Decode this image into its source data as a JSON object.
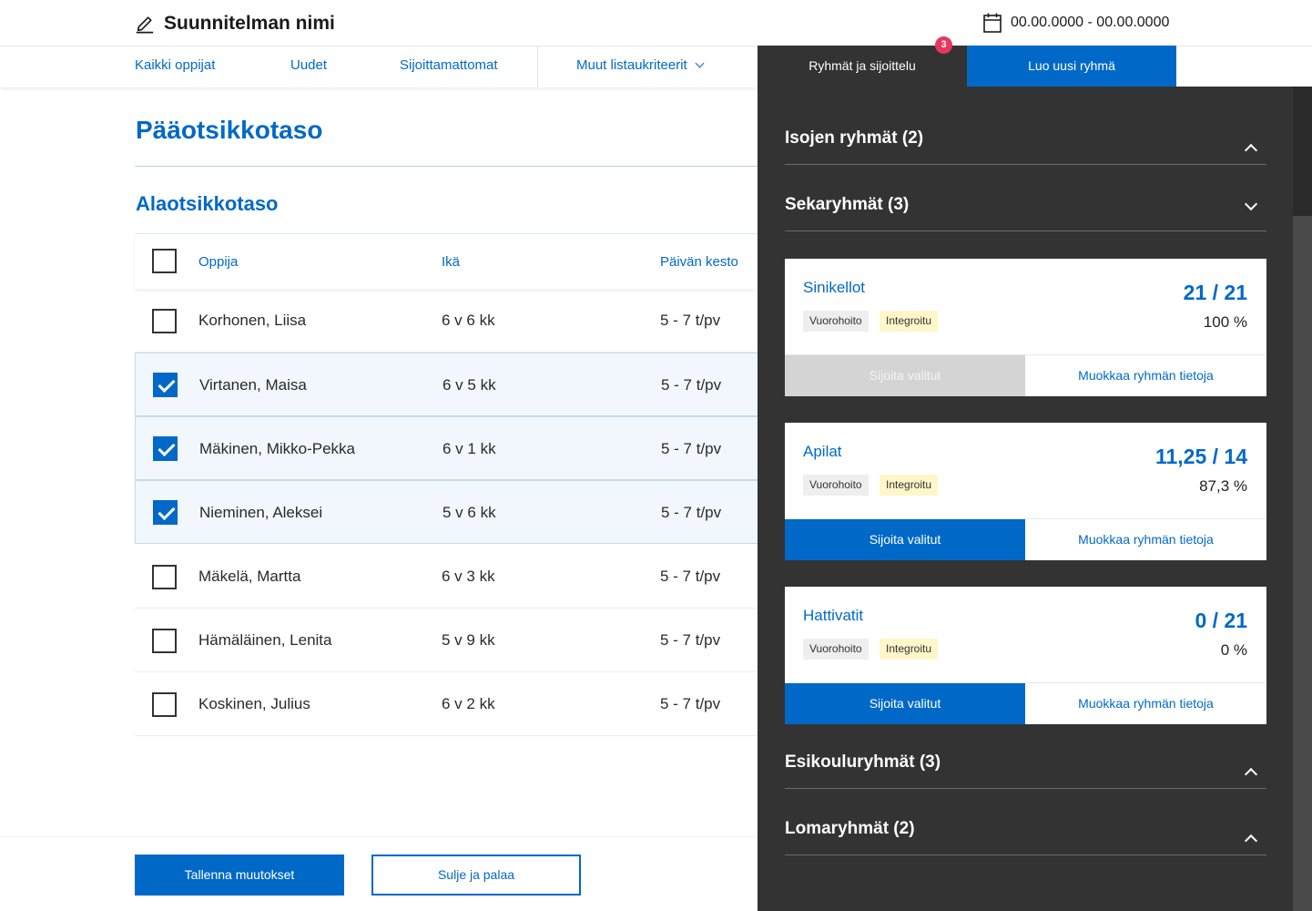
{
  "header": {
    "plan_name": "Suunnitelman nimi",
    "edit_icon": "pencil-icon",
    "calendar_icon": "calendar-icon",
    "date_range": "00.00.0000 - 00.00.0000"
  },
  "nav": {
    "all_learners": "Kaikki oppijat",
    "new": "Uudet",
    "unplaced": "Sijoittamattomat",
    "other_criteria": "Muut listaukriteerit"
  },
  "panel_tabs": {
    "groups": "Ryhmät ja sijoittelu",
    "badge": "3",
    "new_group": "Luo uusi ryhmä"
  },
  "main": {
    "heading": "Pääotsikkotaso",
    "subheading": "Alaotsikkotaso",
    "columns": {
      "learner": "Oppija",
      "age": "Ikä",
      "duration": "Päivän kesto"
    },
    "rows": [
      {
        "name": "Korhonen, Liisa",
        "age": "6 v 6 kk",
        "duration": "5 - 7 t/pv",
        "checked": false
      },
      {
        "name": "Virtanen, Maisa",
        "age": "6 v 5 kk",
        "duration": "5 - 7 t/pv",
        "checked": true
      },
      {
        "name": "Mäkinen, Mikko-Pekka",
        "age": "6 v 1 kk",
        "duration": "5 - 7 t/pv",
        "checked": true
      },
      {
        "name": "Nieminen, Aleksei",
        "age": "5 v 6 kk",
        "duration": "5 - 7 t/pv",
        "checked": true
      },
      {
        "name": "Mäkelä, Martta",
        "age": "6 v 3 kk",
        "duration": "5 - 7 t/pv",
        "checked": false
      },
      {
        "name": "Hämäläinen, Lenita",
        "age": "5 v 9 kk",
        "duration": "5 - 7 t/pv",
        "checked": false
      },
      {
        "name": "Koskinen, Julius",
        "age": "6 v 2 kk",
        "duration": "5 - 7 t/pv",
        "checked": false
      }
    ]
  },
  "footer": {
    "save": "Tallenna muutokset",
    "close": "Sulje ja palaa"
  },
  "panel": {
    "sections": [
      {
        "title": "Isojen ryhmät (2)",
        "expanded": false
      },
      {
        "title": "Sekaryhmät (3)",
        "expanded": true
      },
      {
        "title": "Esikouluryhmät (3)",
        "expanded": false
      },
      {
        "title": "Lomaryhmät (2)",
        "expanded": false
      }
    ],
    "tag_shift": "Vuorohoito",
    "tag_integrated": "Integroitu",
    "place_label": "Sijoita valitut",
    "edit_label": "Muokkaa ryhmän tietoja",
    "groups": [
      {
        "name": "Sinikellot",
        "count": "21 / 21",
        "percent": "100 %",
        "place_enabled": false
      },
      {
        "name": "Apilat",
        "count": "11,25 / 14",
        "percent": "87,3 %",
        "place_enabled": true
      },
      {
        "name": "Hattivatit",
        "count": "0 / 21",
        "percent": "0 %",
        "place_enabled": true
      }
    ]
  },
  "colors": {
    "brand_blue": "#0069c8",
    "panel_dark": "#333333",
    "badge_red": "#e8365d",
    "tag_yellow": "#fff7c9"
  }
}
